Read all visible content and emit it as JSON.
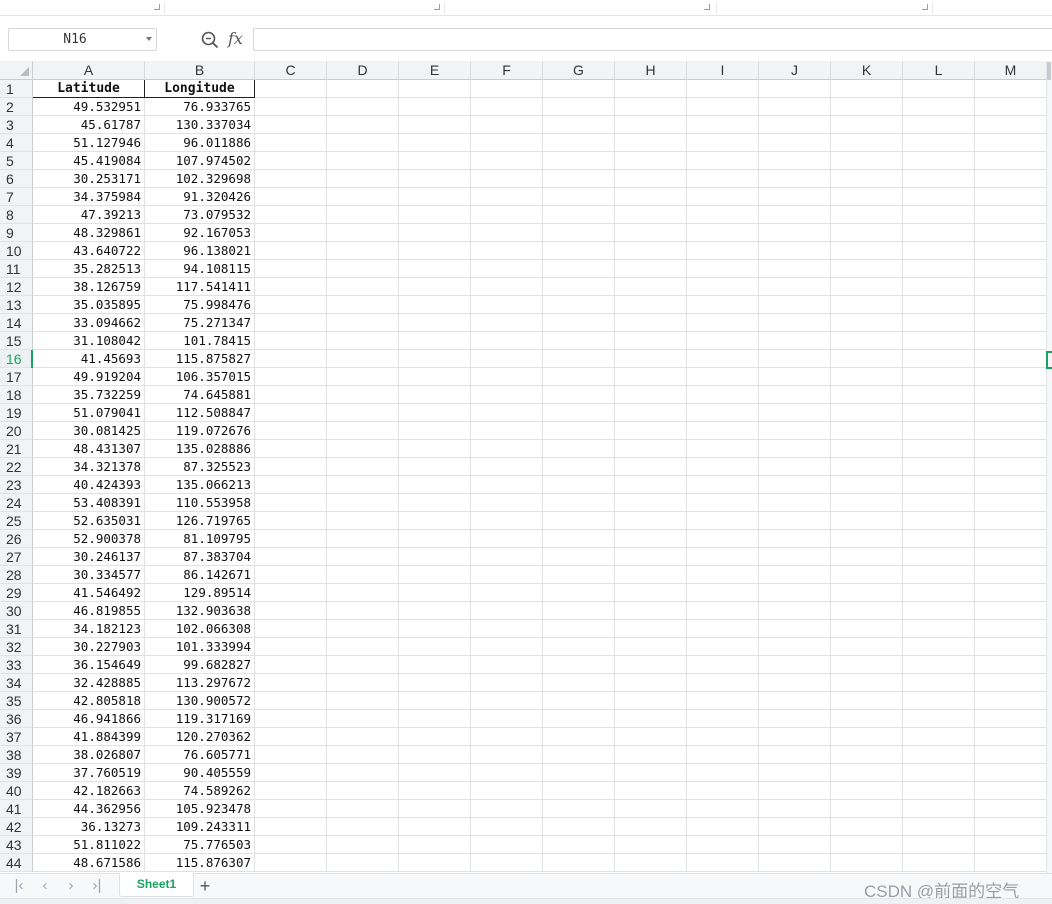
{
  "name_box": {
    "value": "N16"
  },
  "formula_bar": {
    "fx_label": "fx",
    "value": ""
  },
  "columns": [
    "A",
    "B",
    "C",
    "D",
    "E",
    "F",
    "G",
    "H",
    "I",
    "J",
    "K",
    "L",
    "M"
  ],
  "active_row": 16,
  "table": {
    "headers": [
      "Latitude",
      "Longitude"
    ],
    "rows": [
      [
        "49.532951",
        "76.933765"
      ],
      [
        "45.61787",
        "130.337034"
      ],
      [
        "51.127946",
        "96.011886"
      ],
      [
        "45.419084",
        "107.974502"
      ],
      [
        "30.253171",
        "102.329698"
      ],
      [
        "34.375984",
        "91.320426"
      ],
      [
        "47.39213",
        "73.079532"
      ],
      [
        "48.329861",
        "92.167053"
      ],
      [
        "43.640722",
        "96.138021"
      ],
      [
        "35.282513",
        "94.108115"
      ],
      [
        "38.126759",
        "117.541411"
      ],
      [
        "35.035895",
        "75.998476"
      ],
      [
        "33.094662",
        "75.271347"
      ],
      [
        "31.108042",
        "101.78415"
      ],
      [
        "41.45693",
        "115.875827"
      ],
      [
        "49.919204",
        "106.357015"
      ],
      [
        "35.732259",
        "74.645881"
      ],
      [
        "51.079041",
        "112.508847"
      ],
      [
        "30.081425",
        "119.072676"
      ],
      [
        "48.431307",
        "135.028886"
      ],
      [
        "34.321378",
        "87.325523"
      ],
      [
        "40.424393",
        "135.066213"
      ],
      [
        "53.408391",
        "110.553958"
      ],
      [
        "52.635031",
        "126.719765"
      ],
      [
        "52.900378",
        "81.109795"
      ],
      [
        "30.246137",
        "87.383704"
      ],
      [
        "30.334577",
        "86.142671"
      ],
      [
        "41.546492",
        "129.89514"
      ],
      [
        "46.819855",
        "132.903638"
      ],
      [
        "34.182123",
        "102.066308"
      ],
      [
        "30.227903",
        "101.333994"
      ],
      [
        "36.154649",
        "99.682827"
      ],
      [
        "32.428885",
        "113.297672"
      ],
      [
        "42.805818",
        "130.900572"
      ],
      [
        "46.941866",
        "119.317169"
      ],
      [
        "41.884399",
        "120.270362"
      ],
      [
        "38.026807",
        "76.605771"
      ],
      [
        "37.760519",
        "90.405559"
      ],
      [
        "42.182663",
        "74.589262"
      ],
      [
        "44.362956",
        "105.923478"
      ],
      [
        "36.13273",
        "109.243311"
      ],
      [
        "51.811022",
        "75.776503"
      ],
      [
        "48.671586",
        "115.876307"
      ]
    ]
  },
  "sheet_tabs": [
    {
      "label": "Sheet1",
      "active": true
    }
  ],
  "nav": {
    "first": "|‹",
    "prev": "‹",
    "next": "›",
    "last": "›|",
    "add": "+"
  },
  "watermark": "CSDN @前面的空气",
  "icons": {
    "zoom": "zoom-search-icon",
    "fx": "function-icon"
  },
  "colors": {
    "accent": "#1aa260",
    "header_bg": "#f2f3f5",
    "grid_line": "#dfe1e5"
  }
}
